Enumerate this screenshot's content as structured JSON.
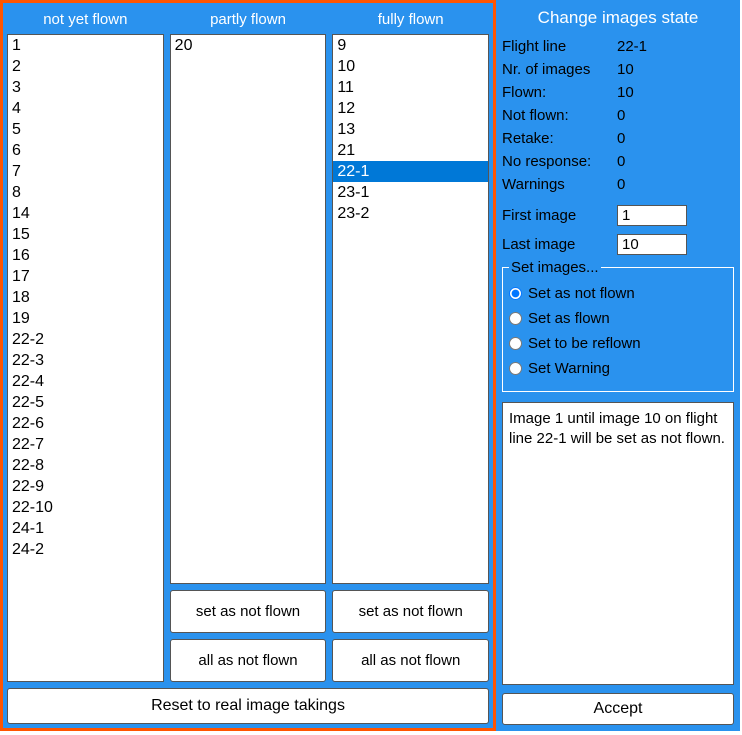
{
  "left": {
    "columns": {
      "not_yet_flown": {
        "header": "not yet flown",
        "items": [
          "1",
          "2",
          "3",
          "4",
          "5",
          "6",
          "7",
          "8",
          "14",
          "15",
          "16",
          "17",
          "18",
          "19",
          "22-2",
          "22-3",
          "22-4",
          "22-5",
          "22-6",
          "22-7",
          "22-8",
          "22-9",
          "22-10",
          "24-1",
          "24-2"
        ]
      },
      "partly_flown": {
        "header": "partly flown",
        "items": [
          "20"
        ],
        "set_btn": "set as not flown",
        "all_btn": "all as not flown"
      },
      "fully_flown": {
        "header": "fully flown",
        "items": [
          "9",
          "10",
          "11",
          "12",
          "13",
          "21",
          "22-1",
          "23-1",
          "23-2"
        ],
        "selected": "22-1",
        "set_btn": "set as not flown",
        "all_btn": "all as not flown"
      }
    },
    "reset_btn": "Reset to real image takings"
  },
  "right": {
    "title": "Change images state",
    "info": {
      "flight_line_label": "Flight line",
      "flight_line_value": "22-1",
      "nr_images_label": "Nr. of images",
      "nr_images_value": "10",
      "flown_label": "Flown:",
      "flown_value": "10",
      "not_flown_label": "Not flown:",
      "not_flown_value": "0",
      "retake_label": "Retake:",
      "retake_value": "0",
      "no_response_label": "No response:",
      "no_response_value": "0",
      "warnings_label": "Warnings",
      "warnings_value": "0"
    },
    "first_image_label": "First image",
    "first_image_value": "1",
    "last_image_label": "Last image",
    "last_image_value": "10",
    "set_images": {
      "legend": "Set images...",
      "opt_not_flown": "Set as not flown",
      "opt_flown": "Set as flown",
      "opt_reflown": "Set to be reflown",
      "opt_warning": "Set Warning",
      "selected": "opt_not_flown"
    },
    "summary": "Image 1 until image 10 on flight line 22-1 will be set as not flown.",
    "accept_btn": "Accept"
  }
}
